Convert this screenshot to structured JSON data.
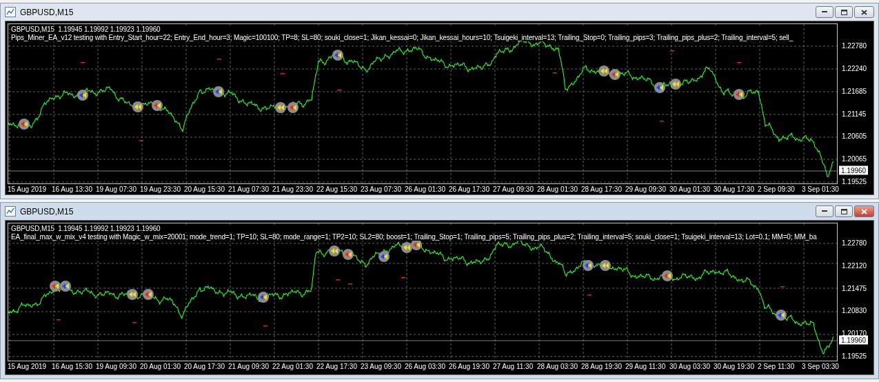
{
  "windows": [
    {
      "title": "GBPUSD,M15",
      "active": false,
      "quote_line": "GBPUSD,M15  1.19945 1.19992 1.19923 1.19960",
      "description": "Pips_Miner_EA_v12 testing with Entry_Start_hour=22; Entry_End_hour=3; Magic=100100; TP=8; SL=80; souki_close=1; Jikan_kessai=0; Jikan_kessai_hours=10; Tsuigeki_interval=13; Trailing_Stop=0; Trailing_pips=3; Trailing_pips_plus=2; Trailing_interval=5; sell_",
      "price_labels": [
        "1.22780",
        "1.22240",
        "1.21685",
        "1.21145",
        "1.20605",
        "1.20065",
        "1.19525"
      ],
      "current_price": "1.19960",
      "time_labels": [
        "15 Aug 2019",
        "16 Aug 13:30",
        "19 Aug 07:30",
        "19 Aug 23:30",
        "20 Aug 15:30",
        "21 Aug 07:30",
        "21 Aug 23:30",
        "22 Aug 15:30",
        "23 Aug 07:30",
        "26 Aug 01:30",
        "26 Aug 17:30",
        "27 Aug 09:30",
        "28 Aug 01:30",
        "28 Aug 17:30",
        "29 Aug 09:30",
        "30 Aug 01:30",
        "30 Aug 17:30",
        "2 Sep 09:30",
        "3 Sep 01:30"
      ]
    },
    {
      "title": "GBPUSD,M15",
      "active": true,
      "quote_line": "GBPUSD,M15  1.19945 1.19992 1.19923 1.19960",
      "description": "EA_final_max_w_mix_v4 testing with Magic_w_mix=20001; mode_trend=1; TP=10; SL=80; mode_range=1; TP2=10; SL2=80; boost=1; Trailing_Stop=1; Trailing_pips=5; Trailing_pips_plus=2; Trailing_interval=5; souki_close=1; Tsuigeki_interval=13; Lot=0.1; MM=0; MM_ba",
      "price_labels": [
        "1.22780",
        "1.22120",
        "1.21475",
        "1.20830",
        "1.20170",
        "1.19525"
      ],
      "current_price": "1.19960",
      "time_labels": [
        "15 Aug 2019",
        "16 Aug 15:30",
        "19 Aug 09:30",
        "20 Aug 01:30",
        "20 Aug 17:30",
        "21 Aug 09:30",
        "22 Aug 01:30",
        "22 Aug 17:30",
        "23 Aug 09:30",
        "26 Aug 03:30",
        "26 Aug 19:30",
        "27 Aug 11:30",
        "28 Aug 03:30",
        "28 Aug 19:30",
        "29 Aug 11:30",
        "30 Aug 03:30",
        "30 Aug 19:30",
        "2 Sep 11:30",
        "3 Sep 03:30"
      ]
    }
  ]
}
